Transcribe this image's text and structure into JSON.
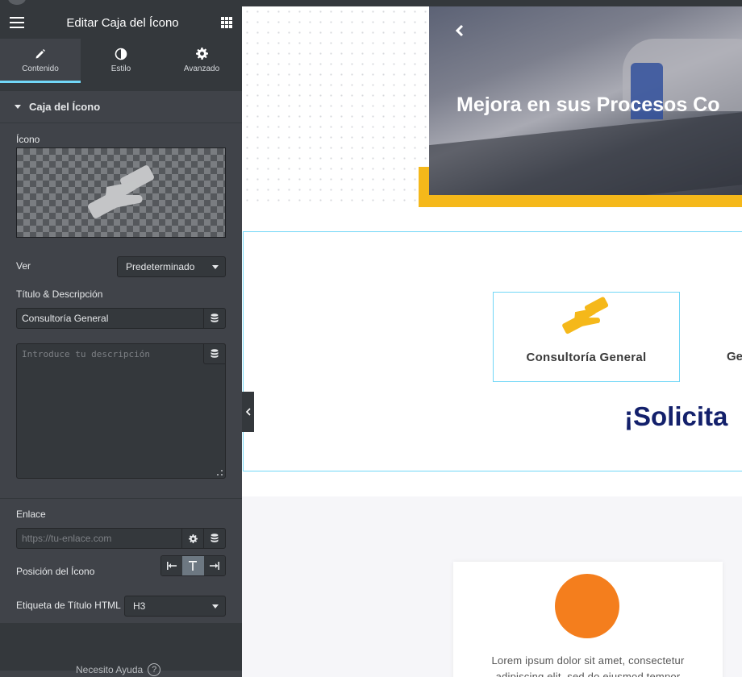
{
  "panel": {
    "title": "Editar Caja del Ícono",
    "tabs": [
      {
        "label": "Contenido",
        "icon": "pencil-icon",
        "active": true
      },
      {
        "label": "Estilo",
        "icon": "half-circle-icon",
        "active": false
      },
      {
        "label": "Avanzado",
        "icon": "gear-icon",
        "active": false
      }
    ],
    "section_title": "Caja del Ícono",
    "icon_label": "Ícono",
    "icon_preview": "handshake-icon",
    "ver_label": "Ver",
    "ver_value": "Predeterminado",
    "title_desc_label": "Título & Descripción",
    "title_value": "Consultoría General",
    "description_placeholder": "Introduce tu descripción",
    "link_label": "Enlace",
    "link_placeholder": "https://tu-enlace.com",
    "icon_position_label": "Posición del Ícono",
    "html_tag_label": "Etiqueta de Título HTML",
    "html_tag_value": "H3",
    "help_text": "Necesito Ayuda"
  },
  "canvas": {
    "hero_title": "Mejora en sus Procesos Co",
    "iconbox_title": "Consultoría General",
    "next_box_text": "Ge",
    "heading": "¡Solicita",
    "card_text_line1": "Lorem ipsum dolor sit amet, consectetur",
    "card_text_line2": "adipiscing elit, sed do eiusmod tempor"
  },
  "colors": {
    "panel_bg": "#404349",
    "panel_dark": "#34383c",
    "accent_blue": "#71d7f7",
    "yellow": "#f5b81a",
    "navy": "#13206b",
    "orange": "#f47e1d"
  }
}
